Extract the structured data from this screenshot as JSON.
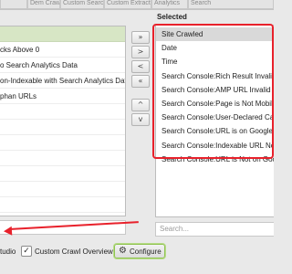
{
  "tabstrip": {
    "tabs": [
      "",
      "Dem Crawl",
      "Custom Search",
      "Custom Extraction",
      "Analytics",
      "Search"
    ]
  },
  "left_list": {
    "items": [
      "",
      "",
      "cks Above 0",
      "o Search Analytics Data",
      "on-Indexable with Search Analytics Data",
      "phan URLs",
      "",
      "",
      "",
      "",
      "",
      ""
    ]
  },
  "move_buttons": {
    "add_all": "»",
    "add": ">",
    "remove": "<",
    "remove_all": "«",
    "move_up": "^",
    "move_down": "v"
  },
  "selected": {
    "label": "Selected",
    "items": [
      "Site Crawled",
      "Date",
      "Time",
      "Search Console:Rich Result Invalid",
      "Search Console:AMP URL Invalid",
      "Search Console:Page is Not Mobile",
      "Search Console:User-Declared Canon",
      "Search Console:URL is on Google Bu",
      "Search Console:Indexable URL Not I",
      "Search Console:URL is Not on Goog"
    ],
    "search_placeholder": "Search..."
  },
  "bottom": {
    "studio_label": "tudio",
    "custom_crawl_overview_label": "Custom Crawl Overview",
    "custom_crawl_overview_checked": true,
    "checkbox_mark": "✓",
    "configure_label": "Configure",
    "gear_glyph": "⚙"
  },
  "colors": {
    "annotation_red": "#e8212b",
    "configure_border": "#8fc34f",
    "selected_row": "#d9d9d9"
  }
}
